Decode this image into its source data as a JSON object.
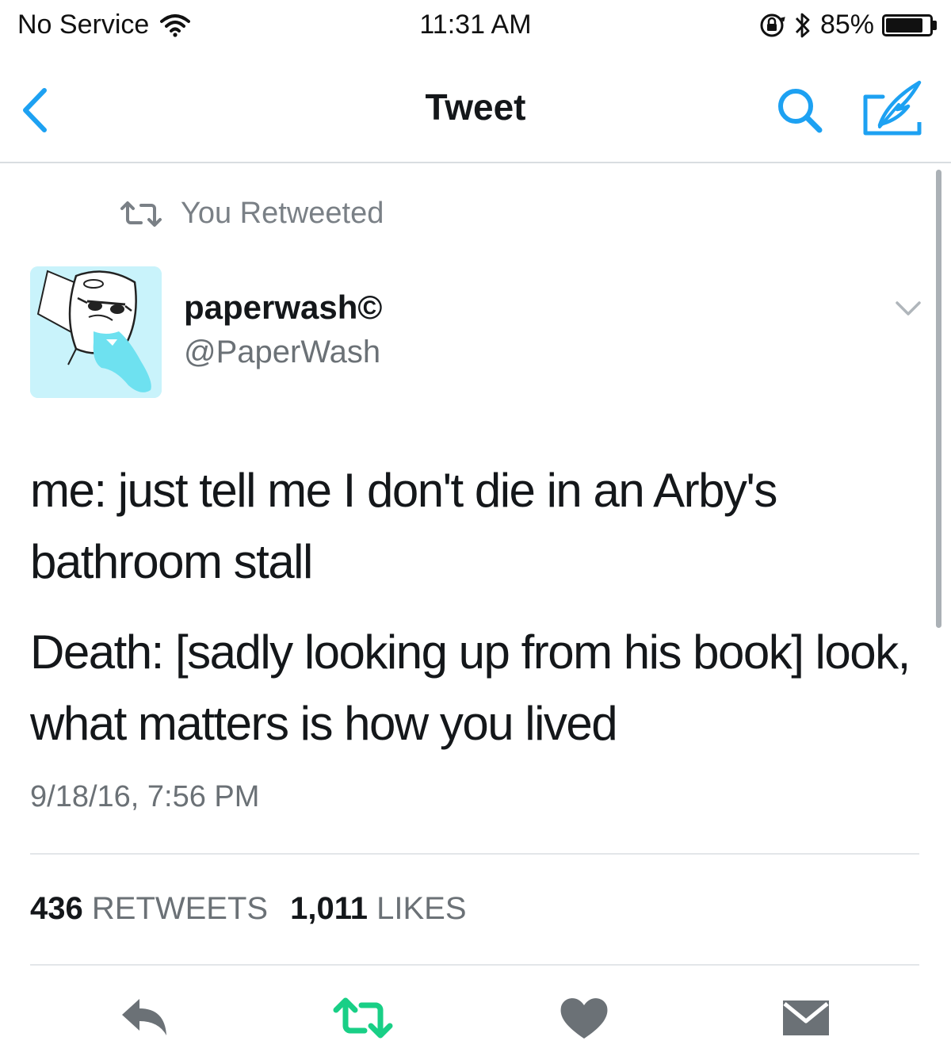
{
  "status_bar": {
    "carrier": "No Service",
    "time": "11:31 AM",
    "battery_percent": "85%",
    "battery_level": 0.85
  },
  "nav": {
    "title": "Tweet"
  },
  "retweet_context": {
    "label": "You Retweeted"
  },
  "author": {
    "display_name": "paperwash©",
    "handle": "@PaperWash"
  },
  "tweet": {
    "paragraphs": [
      "me: just tell me I don't die in an Arby's bathroom stall",
      "Death: [sadly looking up from his book] look, what matters is how you lived"
    ],
    "timestamp": "9/18/16, 7:56 PM"
  },
  "stats": {
    "retweets_count": "436",
    "retweets_label": "RETWEETS",
    "likes_count": "1,011",
    "likes_label": "LIKES"
  },
  "colors": {
    "accent": "#1da1f2",
    "retweet_active": "#19cf86",
    "icon_gray": "#6b7176",
    "text": "#14171a",
    "secondary_text": "#6b7176",
    "avatar_bg": "#c9f3fb"
  },
  "icons": {
    "back": "chevron-left-icon",
    "search": "search-icon",
    "compose": "compose-icon",
    "retweet_context": "retweet-icon",
    "caret": "chevron-down-icon",
    "reply": "reply-icon",
    "retweet": "retweet-icon",
    "like": "heart-icon",
    "dm": "envelope-icon"
  }
}
